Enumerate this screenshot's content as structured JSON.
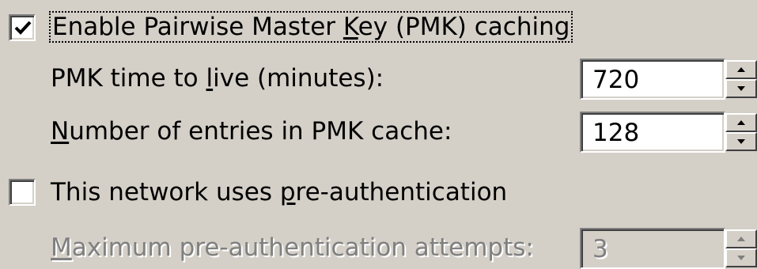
{
  "pmk_caching": {
    "checked": true,
    "label": "Enable Pairwise Master Key (PMK) caching",
    "label_parts": [
      "Enable Pairwise Master ",
      "K",
      "ey (PMK) caching"
    ]
  },
  "pmk_ttl": {
    "label_parts": [
      "PMK time to ",
      "l",
      "ive (minutes):"
    ],
    "value": "720"
  },
  "pmk_entries": {
    "label_parts": [
      "",
      "N",
      "umber of entries in PMK cache:"
    ],
    "value": "128"
  },
  "preauth": {
    "checked": false,
    "label_parts": [
      "This network uses ",
      "p",
      "re-authentication"
    ]
  },
  "preauth_attempts": {
    "label_parts": [
      "",
      "M",
      "aximum pre-authentication attempts:"
    ],
    "value": "3",
    "disabled": true
  },
  "colors": {
    "dialog_bg": "#d4d0c8",
    "disabled_text": "#808080"
  },
  "icons": {
    "checkmark": "checkmark-icon",
    "spin_up": "spin-up-arrow-icon",
    "spin_down": "spin-down-arrow-icon"
  }
}
